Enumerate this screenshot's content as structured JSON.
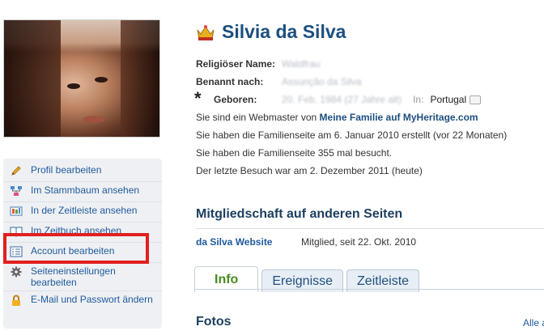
{
  "profile": {
    "name": "Silvia da Silva",
    "facts": {
      "religious_name_label": "Religiöser Name:",
      "religious_name_value": "Waldfrau",
      "named_after_label": "Benannt nach:",
      "named_after_value": "Assunção da Silva",
      "born_label": "Geboren:",
      "born_value": "20. Feb. 1984 (27 Jahre alt)",
      "in_label": "In:",
      "born_place": "Portugal"
    },
    "info_lines": {
      "line1_prefix": "Sie sind ein Webmaster von",
      "line1_link": "Meine Familie auf MyHeritage.com",
      "line2": "Sie haben die Familienseite am 6. Januar 2010 erstellt (vor 22 Monaten)",
      "line3": "Sie haben die Familienseite 355 mal besucht.",
      "line4": "Der letzte Besuch war am 2. Dezember 2011 (heute)"
    }
  },
  "sidebar": {
    "items": [
      {
        "label": "Profil bearbeiten",
        "icon": "pencil-icon"
      },
      {
        "label": "Im Stammbaum ansehen",
        "icon": "tree-icon"
      },
      {
        "label": "In der Zeitleiste ansehen",
        "icon": "timeline-icon"
      },
      {
        "label": "Im Zeitbuch ansehen",
        "icon": "book-icon"
      },
      {
        "label": "Account bearbeiten",
        "icon": "list-icon"
      },
      {
        "label": "Seiteneinstellungen bearbeiten",
        "icon": "gear-icon"
      },
      {
        "label": "E-Mail und Passwort ändern",
        "icon": "lock-icon"
      }
    ]
  },
  "membership": {
    "title": "Mitgliedschaft auf anderen Seiten",
    "site": "da Silva Website",
    "status": "Mitglied, seit 22. Okt. 2010"
  },
  "tabs": [
    {
      "label": "Info",
      "active": true
    },
    {
      "label": "Ereignisse",
      "active": false
    },
    {
      "label": "Zeitleiste",
      "active": false
    }
  ],
  "photos": {
    "title": "Fotos",
    "all_link": "Alle a"
  },
  "colors": {
    "link": "#1f5a9c",
    "heading": "#1c4f7f",
    "highlight": "#e0201f",
    "active_tab": "#4a8a1e"
  }
}
